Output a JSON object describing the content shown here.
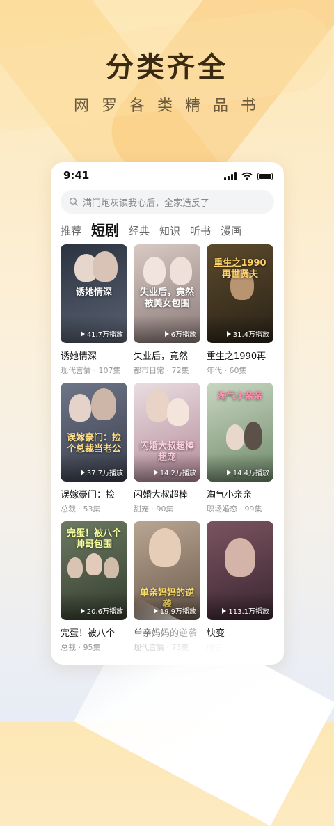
{
  "hero": {
    "title": "分类齐全",
    "subtitle": "网罗各类精品书"
  },
  "status_bar": {
    "time": "9:41"
  },
  "search": {
    "placeholder": "满门炮灰读我心后，全家造反了"
  },
  "tabs": [
    {
      "label": "推荐",
      "active": false
    },
    {
      "label": "短剧",
      "active": true
    },
    {
      "label": "经典",
      "active": false
    },
    {
      "label": "知识",
      "active": false
    },
    {
      "label": "听书",
      "active": false
    },
    {
      "label": "漫画",
      "active": false
    }
  ],
  "cards": [
    {
      "cover_text": "诱她情深",
      "plays": "41.7万播放",
      "title": "诱她情深",
      "meta": "现代言情 · 107集",
      "colors": [
        "#2c3340",
        "#5a6272"
      ]
    },
    {
      "cover_text": "失业后，竟然被美女包围",
      "plays": "6万播放",
      "title": "失业后，竟然",
      "meta": "都市日常 · 72集",
      "colors": [
        "#d9c9c4",
        "#8a7a78"
      ]
    },
    {
      "cover_text": "重生之1990再世贤夫",
      "plays": "31.4万播放",
      "title": "重生之1990再",
      "meta": "年代 · 60集",
      "colors": [
        "#5b4a2c",
        "#2a2217"
      ]
    },
    {
      "cover_text": "误嫁豪门：捡个总裁当老公",
      "plays": "37.7万播放",
      "title": "误嫁豪门：捡",
      "meta": "总裁 · 53集",
      "colors": [
        "#6d7588",
        "#3b3f4c"
      ]
    },
    {
      "cover_text": "闪婚大叔超棒超宠",
      "plays": "14.2万播放",
      "title": "闪婚大叔超棒",
      "meta": "甜宠 · 90集",
      "colors": [
        "#e9dde0",
        "#b48a9a"
      ]
    },
    {
      "cover_text": "淘气小亲亲",
      "plays": "14.4万播放",
      "title": "淘气小亲亲",
      "meta": "职场婚恋 · 99集",
      "colors": [
        "#c9d6c2",
        "#6f8a6a"
      ]
    },
    {
      "cover_text": "完蛋！被八个帅哥包围",
      "plays": "20.6万播放",
      "title": "完蛋！被八个",
      "meta": "总裁 · 95集",
      "colors": [
        "#6c7a62",
        "#343c2e"
      ]
    },
    {
      "cover_text": "单亲妈妈的逆袭",
      "plays": "19.9万播放",
      "title": "单亲妈妈的逆袭",
      "meta": "现代言情 · 73集",
      "colors": [
        "#b9a592",
        "#6b5a4c"
      ]
    },
    {
      "cover_text": "",
      "plays": "113.1万播放",
      "title": "快变",
      "meta": "时空",
      "colors": [
        "#7a5460",
        "#3a2530"
      ]
    }
  ]
}
